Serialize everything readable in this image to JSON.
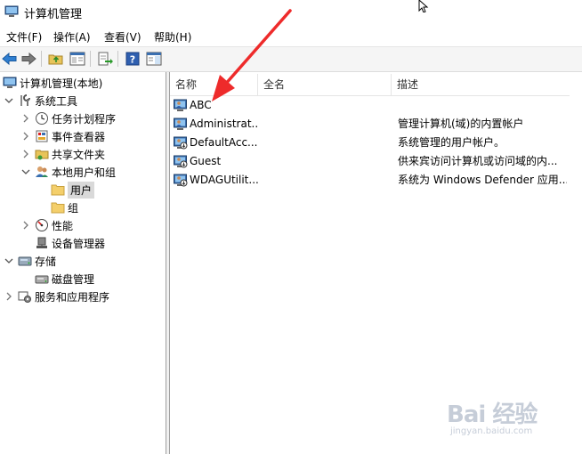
{
  "window": {
    "title": "计算机管理"
  },
  "menu": {
    "file": "文件(F)",
    "action": "操作(A)",
    "view": "查看(V)",
    "help": "帮助(H)"
  },
  "tree": {
    "root": "计算机管理(本地)",
    "system_tools": "系统工具",
    "task_scheduler": "任务计划程序",
    "event_viewer": "事件查看器",
    "shared_folders": "共享文件夹",
    "local_users_groups": "本地用户和组",
    "users": "用户",
    "groups": "组",
    "performance": "性能",
    "device_manager": "设备管理器",
    "storage": "存储",
    "disk_management": "磁盘管理",
    "services_apps": "服务和应用程序"
  },
  "list": {
    "columns": {
      "name": "名称",
      "fullname": "全名",
      "description": "描述"
    },
    "rows": [
      {
        "name": "ABC",
        "fullname": "",
        "description": ""
      },
      {
        "name": "Administrat...",
        "fullname": "",
        "description": "管理计算机(域)的内置帐户"
      },
      {
        "name": "DefaultAcc...",
        "fullname": "",
        "description": "系统管理的用户帐户。"
      },
      {
        "name": "Guest",
        "fullname": "",
        "description": "供来宾访问计算机或访问域的内..."
      },
      {
        "name": "WDAGUtilit...",
        "fullname": "",
        "description": "系统为 Windows Defender 应用..."
      }
    ]
  },
  "watermark": {
    "brand": "Bai 经验",
    "url": "jingyan.baidu.com"
  },
  "colors": {
    "arrow": "#ee2b2b",
    "folder": "#f4cf6b",
    "toolbar": "#f5f5f5",
    "selected": "#d9d9d9"
  }
}
